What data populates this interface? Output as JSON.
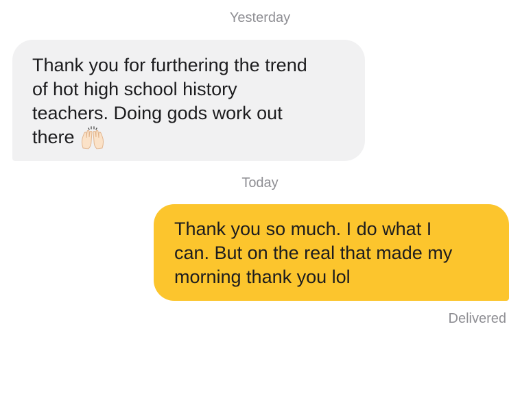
{
  "thread": {
    "day_separators": [
      "Yesterday",
      "Today"
    ],
    "incoming": {
      "text": "Thank you for furthering the trend\nof hot high school history\nteachers. Doing gods work out\nthere",
      "emoji_icon": "raising-hands-icon"
    },
    "outgoing": {
      "text": "Thank you so much.  I do what I\ncan.  But on the real that made my\nmorning thank you lol",
      "bubble_color": "#fcc52d"
    },
    "status": "Delivered"
  }
}
